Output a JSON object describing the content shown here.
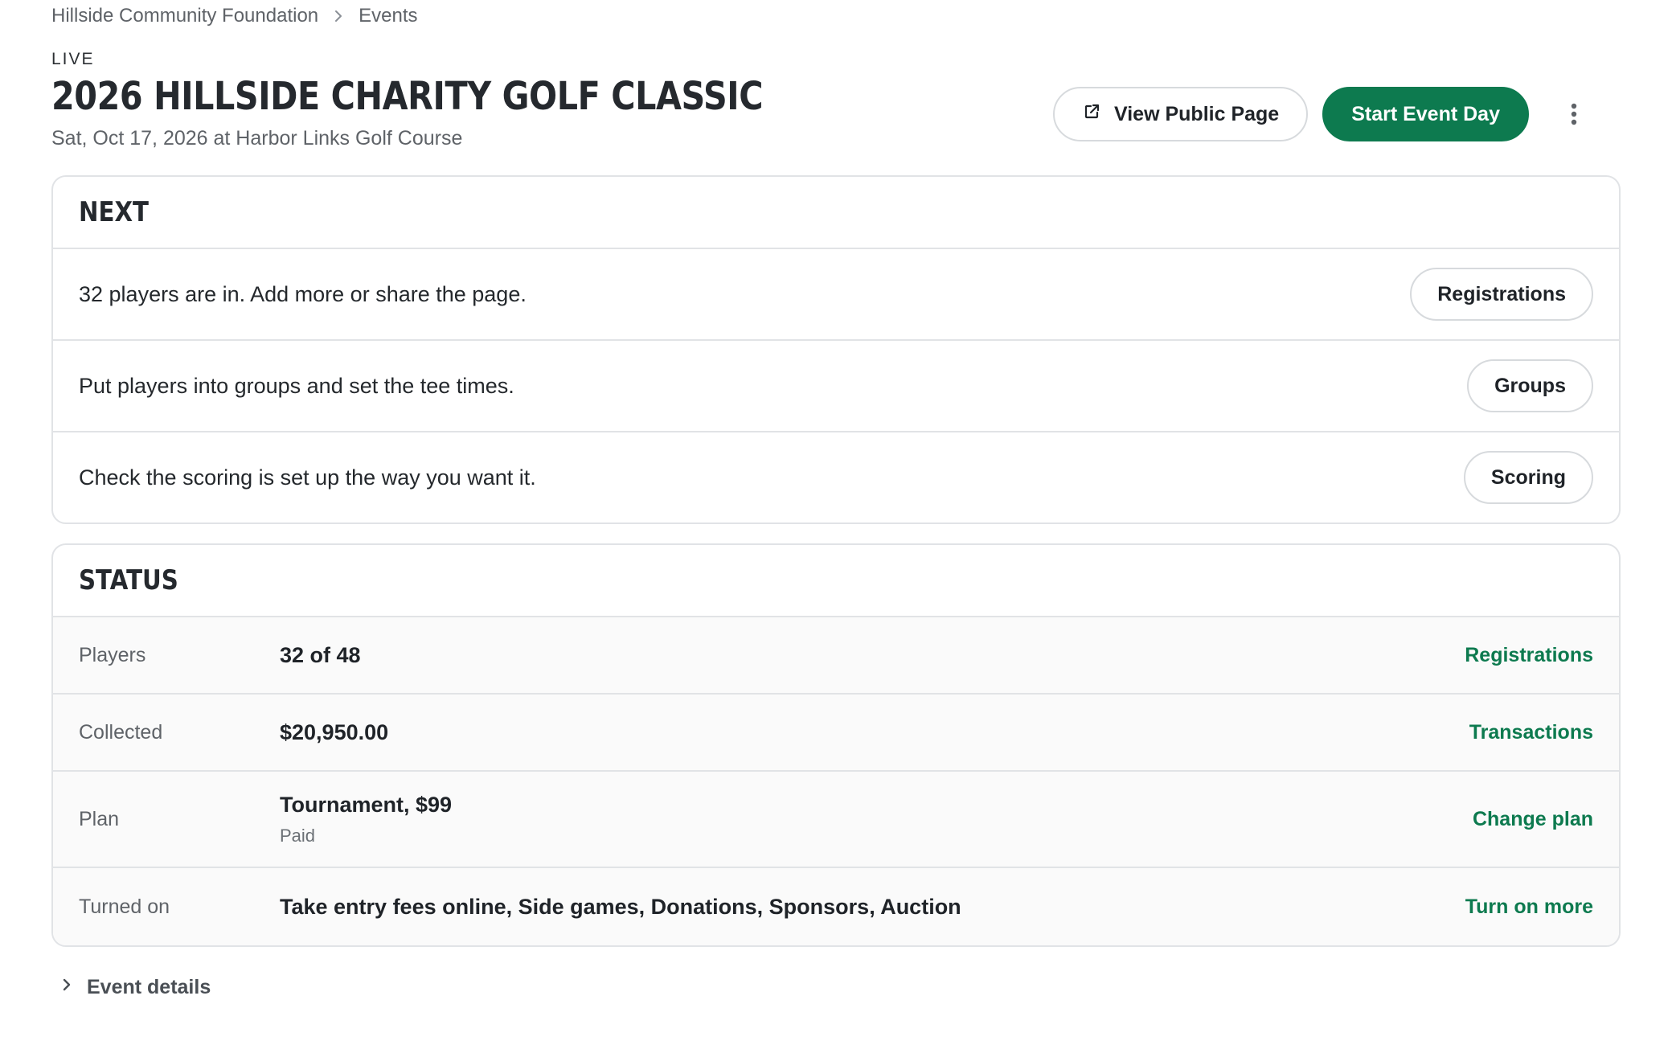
{
  "breadcrumb": {
    "org": "Hillside Community Foundation",
    "section": "Events"
  },
  "header": {
    "status": "LIVE",
    "title": "2026 HILLSIDE CHARITY GOLF CLASSIC",
    "subtitle": "Sat, Oct 17, 2026 at Harbor Links Golf Course",
    "view_public_label": "View Public Page",
    "start_event_label": "Start Event Day"
  },
  "next": {
    "title": "NEXT",
    "rows": [
      {
        "text": "32 players are in. Add more or share the page.",
        "button": "Registrations"
      },
      {
        "text": "Put players into groups and set the tee times.",
        "button": "Groups"
      },
      {
        "text": "Check the scoring is set up the way you want it.",
        "button": "Scoring"
      }
    ]
  },
  "status": {
    "title": "STATUS",
    "rows": [
      {
        "label": "Players",
        "value": "32 of 48",
        "sub": "",
        "link": "Registrations"
      },
      {
        "label": "Collected",
        "value": "$20,950.00",
        "sub": "",
        "link": "Transactions"
      },
      {
        "label": "Plan",
        "value": "Tournament, $99",
        "sub": "Paid",
        "link": "Change plan"
      },
      {
        "label": "Turned on",
        "value": "Take entry fees online, Side games, Donations, Sponsors, Auction",
        "sub": "",
        "link": "Turn on more"
      }
    ]
  },
  "event_details_label": "Event details",
  "colors": {
    "accent": "#0d7a4f",
    "border": "#e1e3e6",
    "muted_text": "#5f6368"
  },
  "icons": {
    "breadcrumb_separator": "chevron-right-icon",
    "view_public": "external-link-icon",
    "more": "more-vertical-icon",
    "details_toggle": "chevron-right-icon"
  }
}
